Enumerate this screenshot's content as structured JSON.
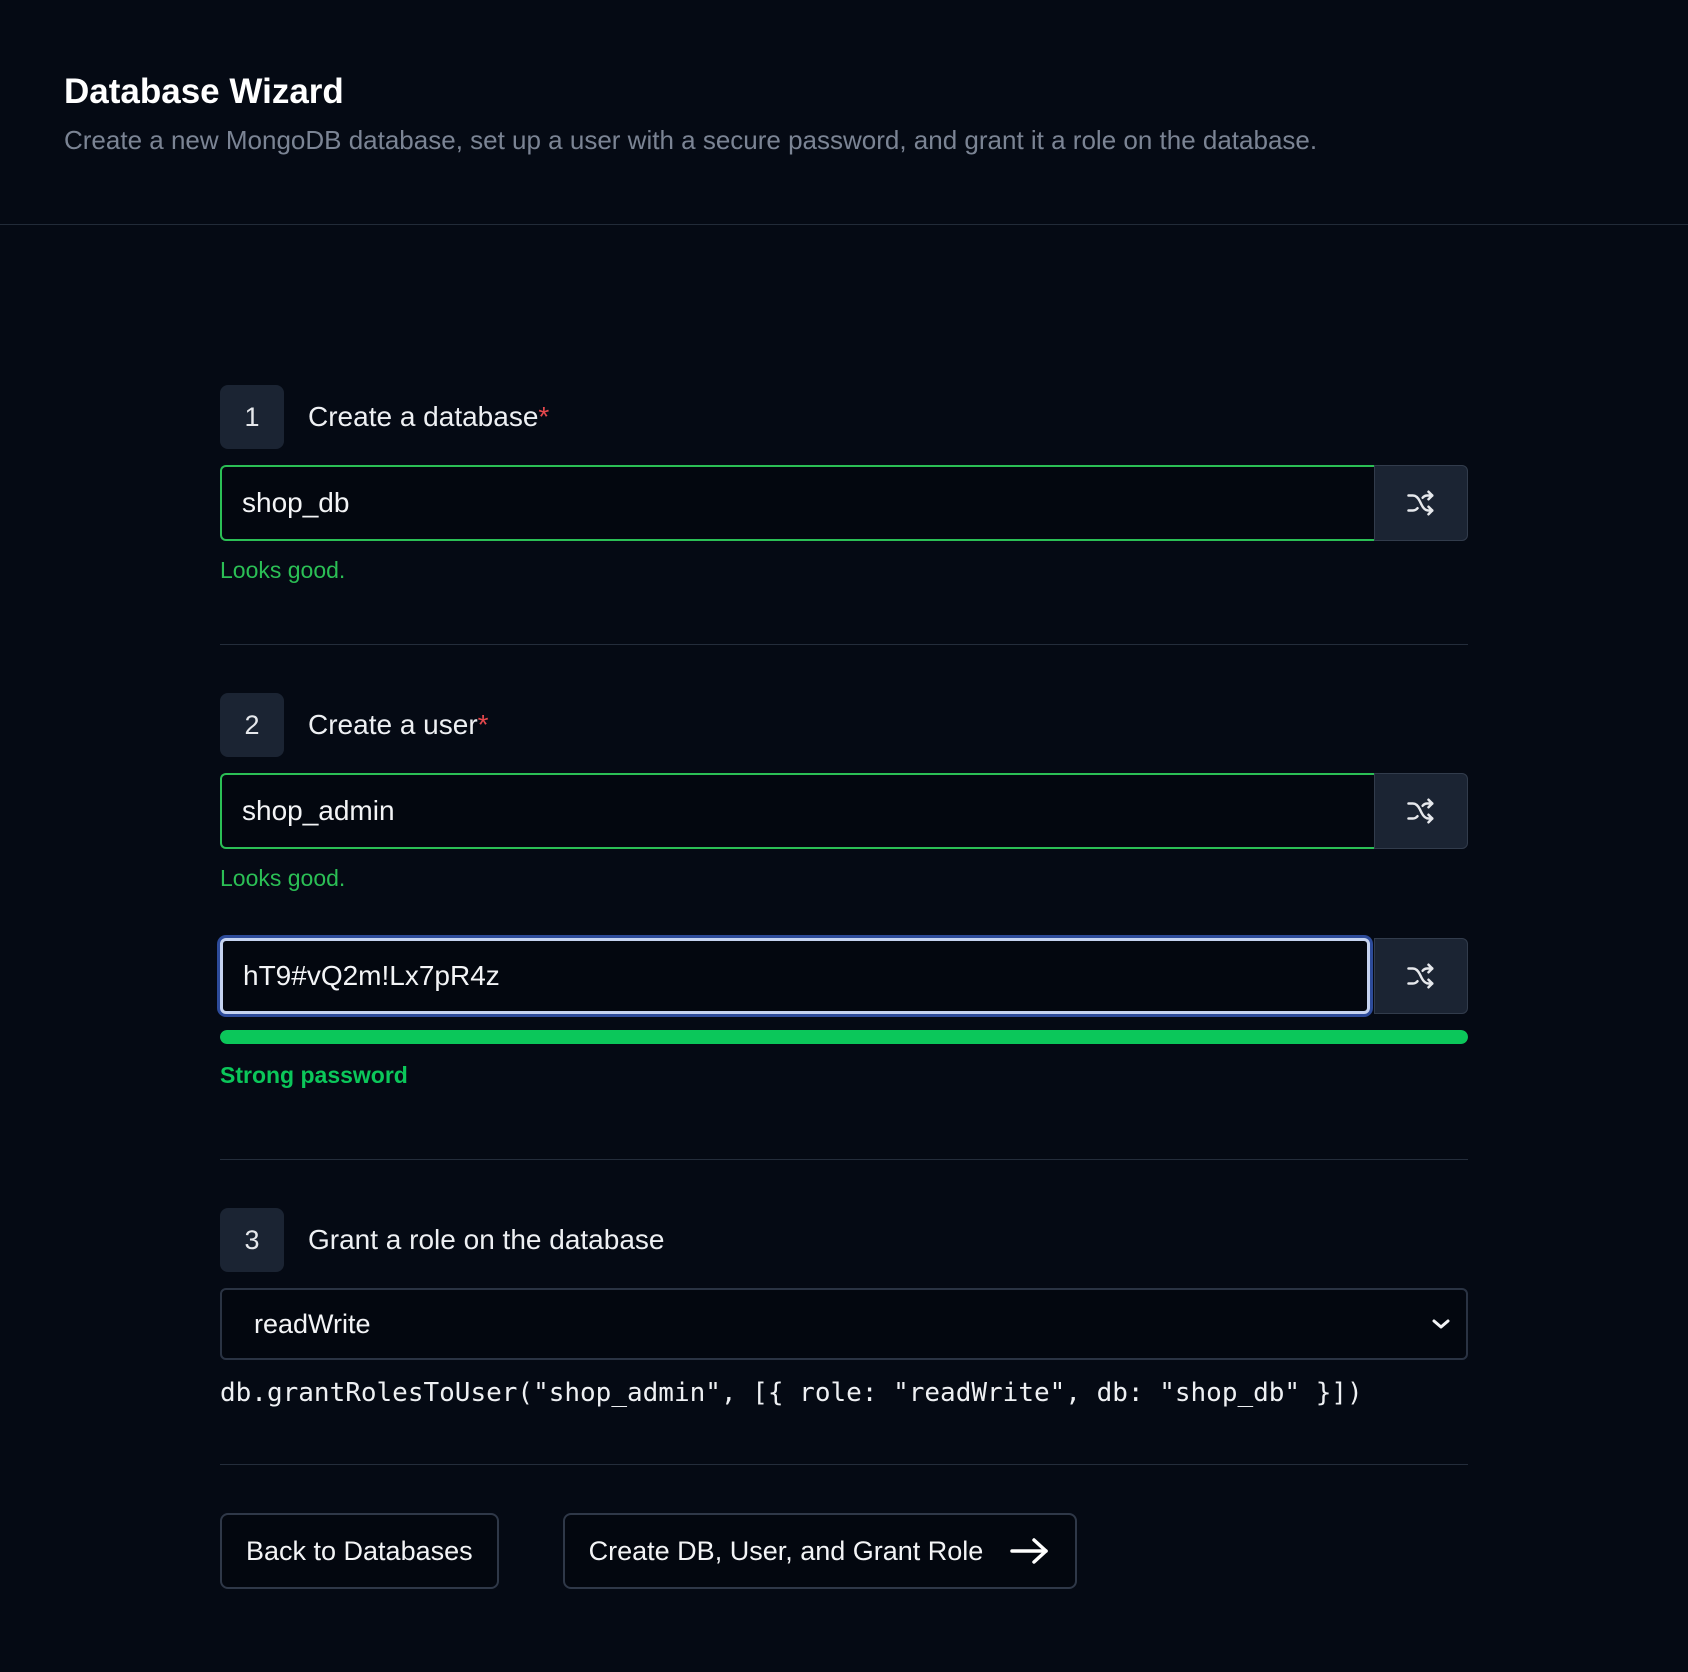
{
  "header": {
    "title": "Database Wizard",
    "subtitle": "Create a new MongoDB database, set up a user with a secure password, and grant it a role on the database."
  },
  "step1": {
    "number": "1",
    "title": "Create a database",
    "required_mark": "*",
    "value": "shop_db",
    "validation": "Looks good."
  },
  "step2": {
    "number": "2",
    "title": "Create a user",
    "required_mark": "*",
    "username_value": "shop_admin",
    "username_validation": "Looks good.",
    "password_value": "hT9#vQ2m!Lx7pR4z",
    "password_strength_percent": 100,
    "password_strength_label": "Strong password"
  },
  "step3": {
    "number": "3",
    "title": "Grant a role on the database",
    "role_selected": "readWrite",
    "command_preview": "db.grantRolesToUser(\"shop_admin\", [{ role: \"readWrite\", db: \"shop_db\" }])"
  },
  "actions": {
    "back_label": "Back to Databases",
    "submit_label": "Create DB, User, and Grant Role"
  },
  "icons": {
    "shuffle": "shuffle-icon",
    "chevron": "chevron-down-icon",
    "arrow": "arrow-right-icon"
  },
  "colors": {
    "background": "#050a14",
    "valid": "#2bbf55",
    "strength": "#0bc75a",
    "required": "#e5484d"
  }
}
